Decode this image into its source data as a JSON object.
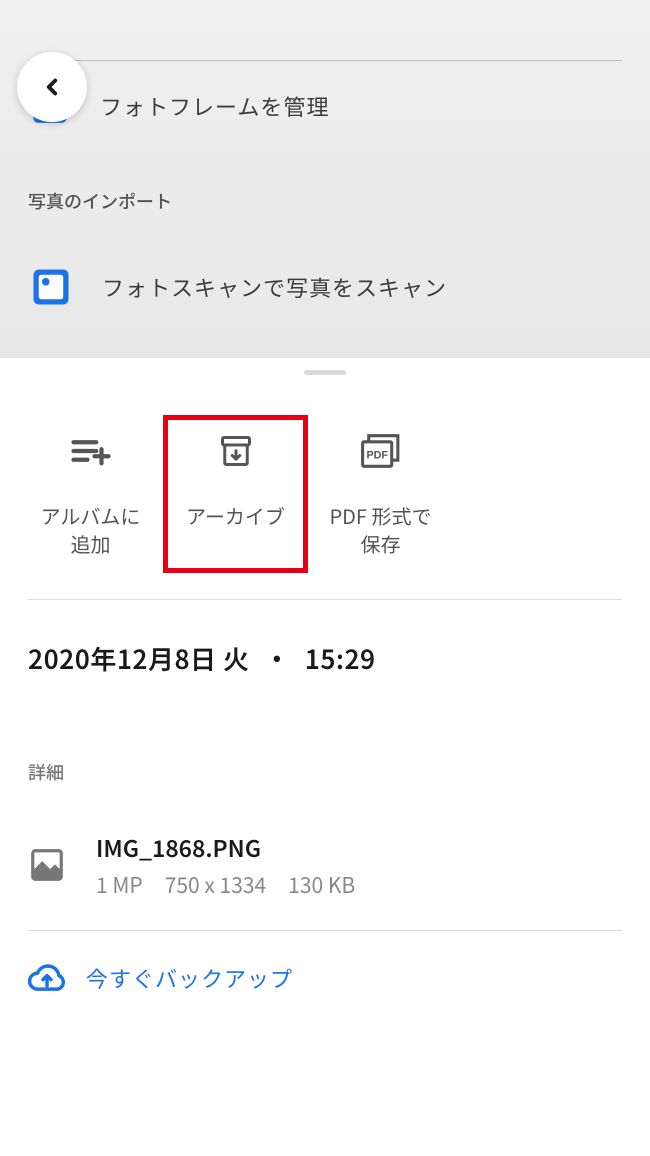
{
  "top": {
    "photo_frame_label": "フォトフレームを管理",
    "import_header": "写真のインポート",
    "scan_label": "フォトスキャンで写真をスキャン"
  },
  "actions": {
    "add_album": "アルバムに\n追加",
    "archive": "アーカイブ",
    "save_pdf": "PDF 形式で\n保存"
  },
  "datetime": {
    "date": "2020年12月8日 火",
    "separator": "・",
    "time": "15:29"
  },
  "details": {
    "header": "詳細",
    "filename": "IMG_1868.PNG",
    "megapixels": "1 MP",
    "dimensions": "750 x 1334",
    "filesize": "130 KB"
  },
  "backup": {
    "label": "今すぐバックアップ"
  }
}
